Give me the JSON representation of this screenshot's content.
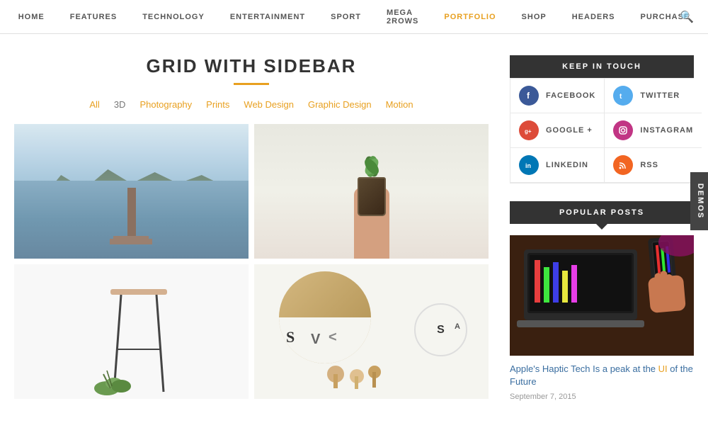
{
  "nav": {
    "items": [
      {
        "label": "HOME",
        "active": false
      },
      {
        "label": "FEATURES",
        "active": false
      },
      {
        "label": "TECHNOLOGY",
        "active": false
      },
      {
        "label": "ENTERTAINMENT",
        "active": false
      },
      {
        "label": "SPORT",
        "active": false
      },
      {
        "label": "MEGA 2ROWS",
        "active": false
      },
      {
        "label": "PORTFOLIO",
        "active": true
      },
      {
        "label": "SHOP",
        "active": false
      },
      {
        "label": "HEADERS",
        "active": false
      },
      {
        "label": "PURCHASE",
        "active": false
      }
    ]
  },
  "page": {
    "title": "GRID WITH SIDEBAR",
    "title_underline_color": "#e8a020"
  },
  "filters": {
    "items": [
      {
        "label": "All",
        "active": true
      },
      {
        "label": "3D",
        "active": false
      },
      {
        "label": "Photography",
        "active": false
      },
      {
        "label": "Prints",
        "active": false
      },
      {
        "label": "Web Design",
        "active": false
      },
      {
        "label": "Graphic Design",
        "active": false
      },
      {
        "label": "Motion",
        "active": false
      }
    ]
  },
  "sidebar": {
    "keep_in_touch": {
      "header": "KEEP IN TOUCH",
      "social_items": [
        {
          "label": "FACEBOOK",
          "icon": "f",
          "color": "#3b5998"
        },
        {
          "label": "TWITTER",
          "icon": "t",
          "color": "#55acee"
        },
        {
          "label": "GOOGLE +",
          "icon": "g+",
          "color": "#dd4b39"
        },
        {
          "label": "INSTAGRAM",
          "icon": "ig",
          "color": "#c13584"
        },
        {
          "label": "LINKEDIN",
          "icon": "in",
          "color": "#0077b5"
        },
        {
          "label": "RSS",
          "icon": "rss",
          "color": "#f26522"
        }
      ]
    },
    "popular_posts": {
      "header": "POPULAR POSTS",
      "items": [
        {
          "title": "Apple's Haptic Tech Is a peak at the UI of the Future",
          "date": "September 7, 2015",
          "highlighted_words": [
            "UI"
          ]
        }
      ]
    }
  },
  "demos_label": "DEMOS"
}
